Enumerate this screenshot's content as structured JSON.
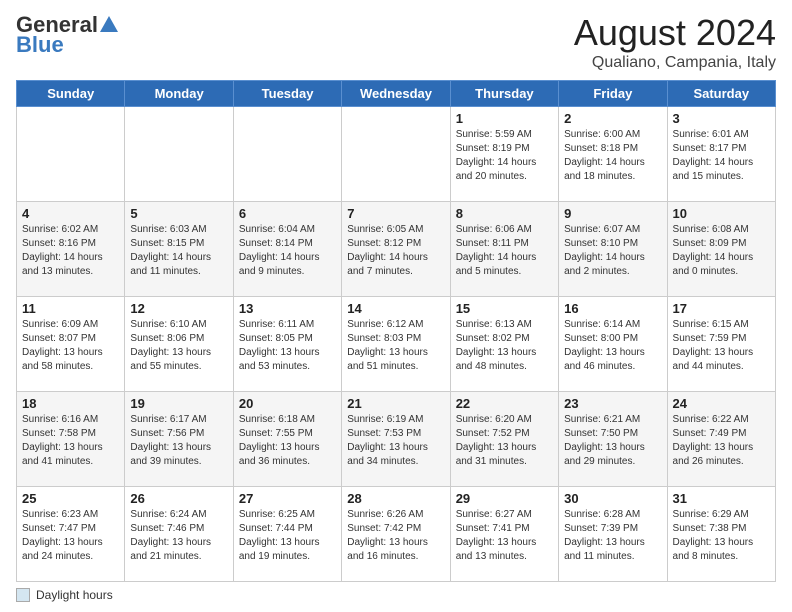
{
  "header": {
    "logo_line1": "General",
    "logo_line2": "Blue",
    "title": "August 2024",
    "subtitle": "Qualiano, Campania, Italy"
  },
  "days_of_week": [
    "Sunday",
    "Monday",
    "Tuesday",
    "Wednesday",
    "Thursday",
    "Friday",
    "Saturday"
  ],
  "weeks": [
    [
      {
        "day": "",
        "info": ""
      },
      {
        "day": "",
        "info": ""
      },
      {
        "day": "",
        "info": ""
      },
      {
        "day": "",
        "info": ""
      },
      {
        "day": "1",
        "info": "Sunrise: 5:59 AM\nSunset: 8:19 PM\nDaylight: 14 hours and 20 minutes."
      },
      {
        "day": "2",
        "info": "Sunrise: 6:00 AM\nSunset: 8:18 PM\nDaylight: 14 hours and 18 minutes."
      },
      {
        "day": "3",
        "info": "Sunrise: 6:01 AM\nSunset: 8:17 PM\nDaylight: 14 hours and 15 minutes."
      }
    ],
    [
      {
        "day": "4",
        "info": "Sunrise: 6:02 AM\nSunset: 8:16 PM\nDaylight: 14 hours and 13 minutes."
      },
      {
        "day": "5",
        "info": "Sunrise: 6:03 AM\nSunset: 8:15 PM\nDaylight: 14 hours and 11 minutes."
      },
      {
        "day": "6",
        "info": "Sunrise: 6:04 AM\nSunset: 8:14 PM\nDaylight: 14 hours and 9 minutes."
      },
      {
        "day": "7",
        "info": "Sunrise: 6:05 AM\nSunset: 8:12 PM\nDaylight: 14 hours and 7 minutes."
      },
      {
        "day": "8",
        "info": "Sunrise: 6:06 AM\nSunset: 8:11 PM\nDaylight: 14 hours and 5 minutes."
      },
      {
        "day": "9",
        "info": "Sunrise: 6:07 AM\nSunset: 8:10 PM\nDaylight: 14 hours and 2 minutes."
      },
      {
        "day": "10",
        "info": "Sunrise: 6:08 AM\nSunset: 8:09 PM\nDaylight: 14 hours and 0 minutes."
      }
    ],
    [
      {
        "day": "11",
        "info": "Sunrise: 6:09 AM\nSunset: 8:07 PM\nDaylight: 13 hours and 58 minutes."
      },
      {
        "day": "12",
        "info": "Sunrise: 6:10 AM\nSunset: 8:06 PM\nDaylight: 13 hours and 55 minutes."
      },
      {
        "day": "13",
        "info": "Sunrise: 6:11 AM\nSunset: 8:05 PM\nDaylight: 13 hours and 53 minutes."
      },
      {
        "day": "14",
        "info": "Sunrise: 6:12 AM\nSunset: 8:03 PM\nDaylight: 13 hours and 51 minutes."
      },
      {
        "day": "15",
        "info": "Sunrise: 6:13 AM\nSunset: 8:02 PM\nDaylight: 13 hours and 48 minutes."
      },
      {
        "day": "16",
        "info": "Sunrise: 6:14 AM\nSunset: 8:00 PM\nDaylight: 13 hours and 46 minutes."
      },
      {
        "day": "17",
        "info": "Sunrise: 6:15 AM\nSunset: 7:59 PM\nDaylight: 13 hours and 44 minutes."
      }
    ],
    [
      {
        "day": "18",
        "info": "Sunrise: 6:16 AM\nSunset: 7:58 PM\nDaylight: 13 hours and 41 minutes."
      },
      {
        "day": "19",
        "info": "Sunrise: 6:17 AM\nSunset: 7:56 PM\nDaylight: 13 hours and 39 minutes."
      },
      {
        "day": "20",
        "info": "Sunrise: 6:18 AM\nSunset: 7:55 PM\nDaylight: 13 hours and 36 minutes."
      },
      {
        "day": "21",
        "info": "Sunrise: 6:19 AM\nSunset: 7:53 PM\nDaylight: 13 hours and 34 minutes."
      },
      {
        "day": "22",
        "info": "Sunrise: 6:20 AM\nSunset: 7:52 PM\nDaylight: 13 hours and 31 minutes."
      },
      {
        "day": "23",
        "info": "Sunrise: 6:21 AM\nSunset: 7:50 PM\nDaylight: 13 hours and 29 minutes."
      },
      {
        "day": "24",
        "info": "Sunrise: 6:22 AM\nSunset: 7:49 PM\nDaylight: 13 hours and 26 minutes."
      }
    ],
    [
      {
        "day": "25",
        "info": "Sunrise: 6:23 AM\nSunset: 7:47 PM\nDaylight: 13 hours and 24 minutes."
      },
      {
        "day": "26",
        "info": "Sunrise: 6:24 AM\nSunset: 7:46 PM\nDaylight: 13 hours and 21 minutes."
      },
      {
        "day": "27",
        "info": "Sunrise: 6:25 AM\nSunset: 7:44 PM\nDaylight: 13 hours and 19 minutes."
      },
      {
        "day": "28",
        "info": "Sunrise: 6:26 AM\nSunset: 7:42 PM\nDaylight: 13 hours and 16 minutes."
      },
      {
        "day": "29",
        "info": "Sunrise: 6:27 AM\nSunset: 7:41 PM\nDaylight: 13 hours and 13 minutes."
      },
      {
        "day": "30",
        "info": "Sunrise: 6:28 AM\nSunset: 7:39 PM\nDaylight: 13 hours and 11 minutes."
      },
      {
        "day": "31",
        "info": "Sunrise: 6:29 AM\nSunset: 7:38 PM\nDaylight: 13 hours and 8 minutes."
      }
    ]
  ],
  "footer": {
    "label": "Daylight hours"
  }
}
